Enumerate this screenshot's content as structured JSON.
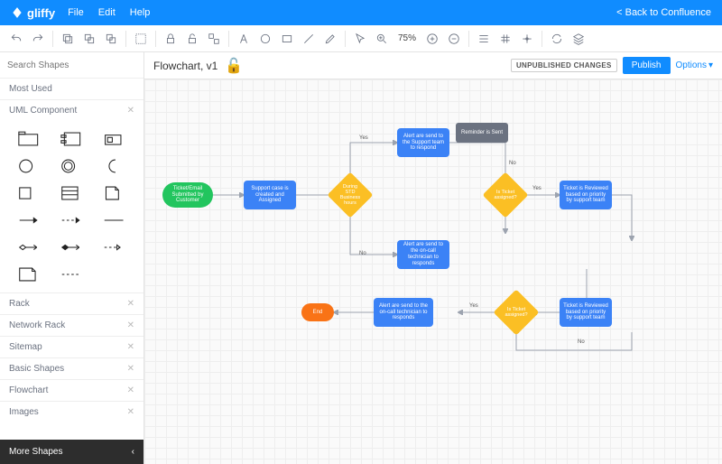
{
  "topbar": {
    "brand": "gliffy",
    "menu": [
      "File",
      "Edit",
      "Help"
    ],
    "back": "< Back to Confluence"
  },
  "toolbar": {
    "zoom": "75%"
  },
  "sidebar": {
    "search_placeholder": "Search Shapes",
    "sections_top": [
      "Most Used",
      "UML Component"
    ],
    "sections_bottom": [
      "Rack",
      "Network Rack",
      "Sitemap",
      "Basic Shapes",
      "Flowchart",
      "Images"
    ],
    "more": "More Shapes"
  },
  "doc": {
    "title": "Flowchart, v1",
    "badge": "UNPUBLISHED CHANGES",
    "publish": "Publish",
    "options": "Options"
  },
  "nodes": {
    "start": "Ticket/Email Submitted by Customer",
    "n1": "Support case is created and Assigned",
    "d1": "During STD Business hours",
    "n2": "Alert are send to the Support team to respond",
    "n3": "Alert are send to the on-call technician to responds",
    "gray": "Reminder is Sent",
    "d2": "Is Ticket assigned?",
    "n4": "Ticket is Reviewed based on priority by support team",
    "n5": "Ticket is Reviewed based on priority by support team",
    "d3": "Is Ticket assigned?",
    "n6": "Alert are send to the on-call technician to responds",
    "end": "End"
  },
  "labels": {
    "yes": "Yes",
    "no": "No"
  }
}
